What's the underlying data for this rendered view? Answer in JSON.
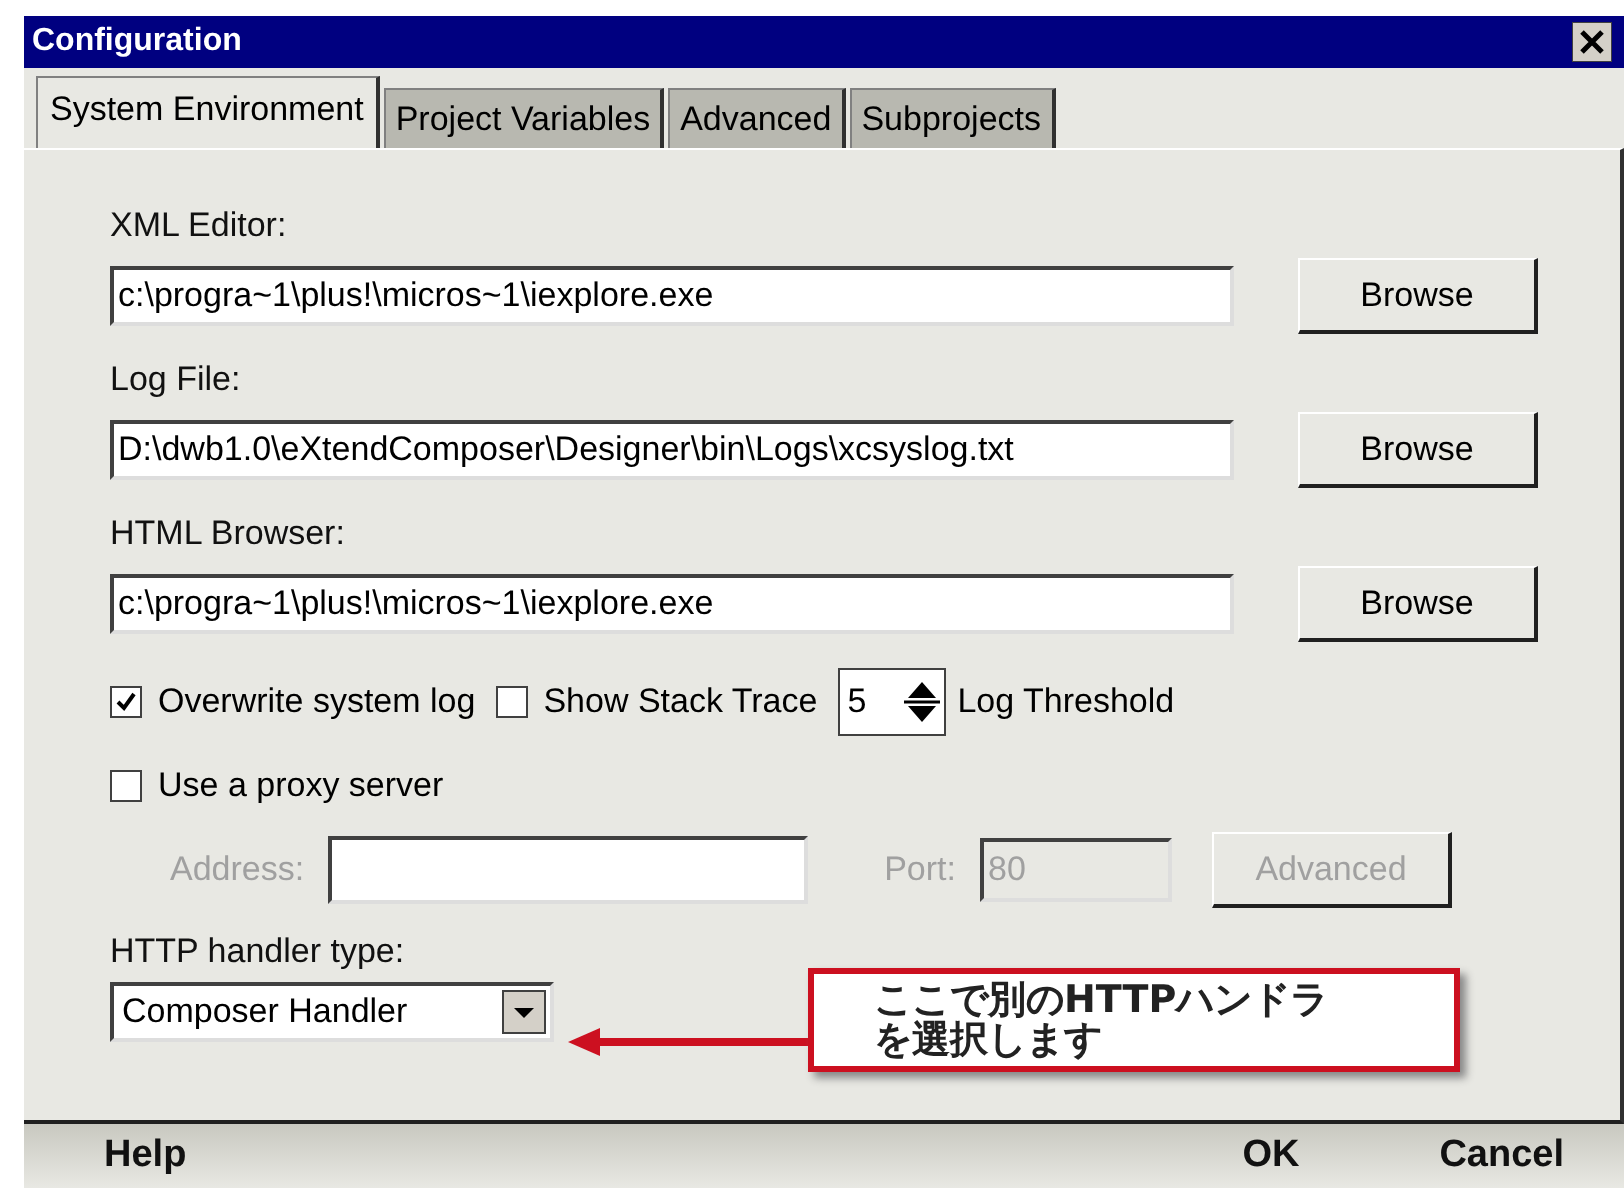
{
  "window": {
    "title": "Configuration"
  },
  "tabs": [
    {
      "label": "System Environment",
      "selected": true
    },
    {
      "label": "Project Variables",
      "selected": false
    },
    {
      "label": "Advanced",
      "selected": false
    },
    {
      "label": "Subprojects",
      "selected": false
    }
  ],
  "paths": [
    {
      "label": "XML Editor:",
      "value": "c:\\progra~1\\plus!\\micros~1\\iexplore.exe",
      "button": "Browse"
    },
    {
      "label": "Log File:",
      "value": "D:\\dwb1.0\\eXtendComposer\\Designer\\bin\\Logs\\xcsyslog.txt",
      "button": "Browse"
    },
    {
      "label": "HTML Browser:",
      "value": "c:\\progra~1\\plus!\\micros~1\\iexplore.exe",
      "button": "Browse"
    }
  ],
  "log_options": {
    "overwrite": {
      "label": "Overwrite system log",
      "checked": true
    },
    "stack_trace": {
      "label": "Show Stack Trace",
      "checked": false
    },
    "threshold": {
      "value": "5",
      "label": "Log Threshold"
    }
  },
  "proxy": {
    "label": "Use a proxy server",
    "checked": false,
    "disabled": true,
    "address_label": "Address:",
    "port_label": "Port:",
    "port_value": "80",
    "button": "Advanced"
  },
  "handler": {
    "label": "HTTP handler type:",
    "value": "Composer Handler"
  },
  "callout": {
    "lines": [
      "ここで別のHTTPハンドラ",
      "を選択します"
    ]
  },
  "footer": [
    "Help",
    "OK",
    "Cancel"
  ]
}
